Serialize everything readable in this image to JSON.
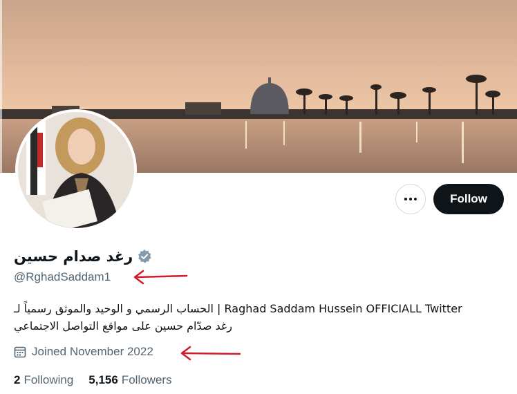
{
  "profile": {
    "display_name": "رغد صدام حسين",
    "handle": "@RghadSaddam1",
    "bio_line1": "الحساب الرسمي و الوحيد والموثق رسمياً لـ | Raghad Saddam Hussein OFFICIALL Twitter",
    "bio_line2": "رغد صدّام حسين على مواقع التواصل الاجتماعي",
    "joined": "Joined November 2022",
    "following_count": "2",
    "following_label": "Following",
    "followers_count": "5,156",
    "followers_label": "Followers"
  },
  "actions": {
    "follow_label": "Follow"
  },
  "icons": {
    "more": "more-dots-icon",
    "verified": "verified-badge-icon",
    "calendar": "calendar-icon",
    "annotation": "red-arrow-icon"
  },
  "colors": {
    "verified": "#829aab",
    "follow_bg": "#0f1419",
    "muted_text": "#536471",
    "annotation": "#d11a2a"
  }
}
